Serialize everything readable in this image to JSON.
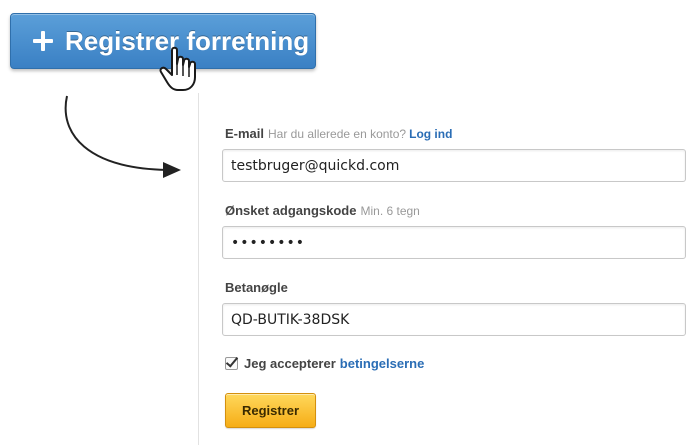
{
  "header": {
    "register_business_label": "Registrer forretning"
  },
  "form": {
    "email": {
      "label": "E-mail",
      "hint": "Har du allerede en konto?",
      "login_link": "Log ind",
      "value": "testbruger@quickd.com"
    },
    "password": {
      "label": "Ønsket adgangskode",
      "hint": "Min. 6 tegn",
      "value": "pass1234"
    },
    "beta_key": {
      "label": "Betanøgle",
      "value": "QD-BUTIK-38DSK"
    },
    "terms": {
      "checked": true,
      "label": "Jeg accepterer",
      "link": "betingelserne"
    },
    "submit_label": "Registrer"
  },
  "colors": {
    "primary_button": "#4a90d3",
    "accent_button": "#f8b82a",
    "link": "#2a6db5"
  },
  "icons": [
    "plus-icon",
    "hand-cursor-icon",
    "curved-arrow-icon",
    "checkbox-icon"
  ]
}
